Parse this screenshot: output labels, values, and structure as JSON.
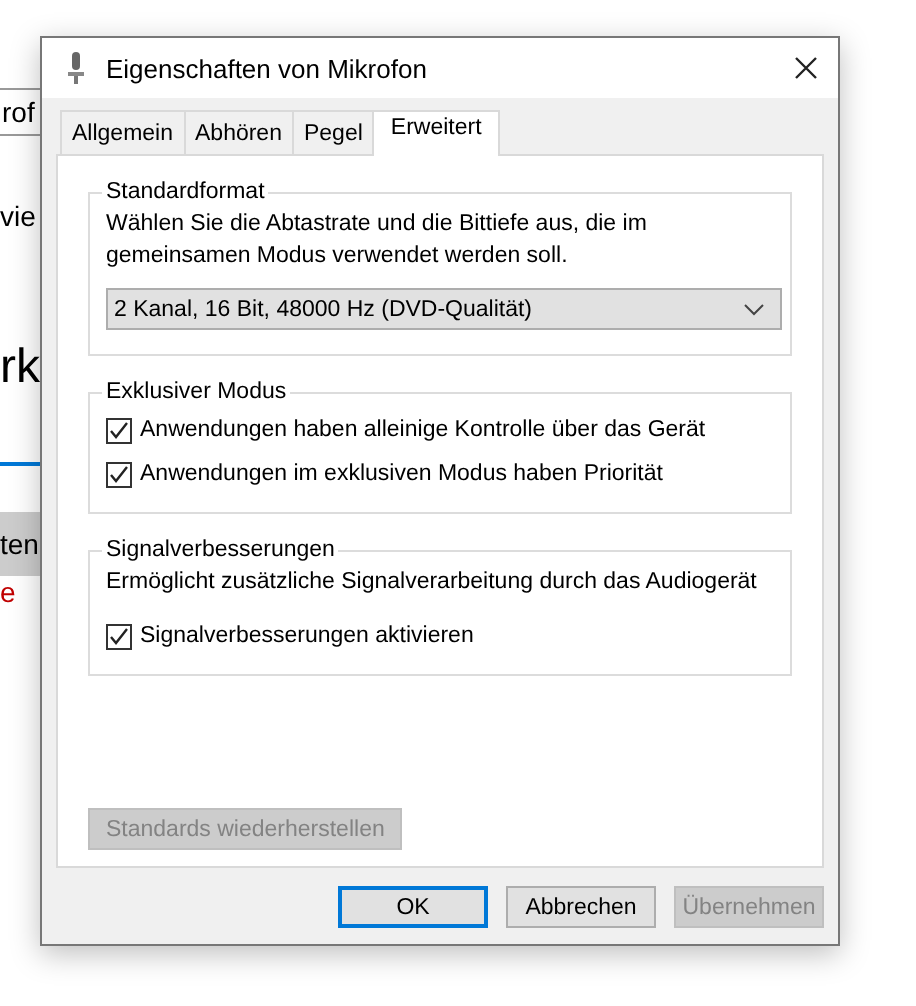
{
  "background_window": {
    "fragments": [
      {
        "kind": "field",
        "text": "rof"
      },
      {
        "kind": "text",
        "text": "vie"
      },
      {
        "kind": "heading",
        "text": "rk"
      },
      {
        "kind": "button",
        "text": "ten"
      },
      {
        "kind": "error",
        "text": "e"
      }
    ]
  },
  "dialog": {
    "title": "Eigenschaften von Mikrofon",
    "tabs": [
      {
        "label": "Allgemein",
        "selected": false
      },
      {
        "label": "Abhören",
        "selected": false
      },
      {
        "label": "Pegel",
        "selected": false
      },
      {
        "label": "Erweitert",
        "selected": true
      }
    ],
    "groups": [
      {
        "title": "Standardformat",
        "description": "Wählen Sie die Abtastrate und die Bittiefe aus, die im gemeinsamen Modus verwendet werden soll.",
        "select": {
          "value": "2 Kanal, 16 Bit, 48000 Hz (DVD-Qualität)"
        }
      },
      {
        "title": "Exklusiver Modus",
        "checkboxes": [
          {
            "label": "Anwendungen haben alleinige Kontrolle über das Gerät",
            "checked": true
          },
          {
            "label": "Anwendungen im exklusiven Modus haben Priorität",
            "checked": true
          }
        ]
      },
      {
        "title": "Signalverbesserungen",
        "description": "Ermöglicht zusätzliche Signalverarbeitung durch das Audiogerät",
        "checkboxes": [
          {
            "label": "Signalverbesserungen aktivieren",
            "checked": true
          }
        ]
      }
    ],
    "restore_button": {
      "label": "Standards wiederherstellen",
      "disabled": true
    },
    "buttons": [
      {
        "label": "OK",
        "default": true,
        "disabled": false
      },
      {
        "label": "Abbrechen",
        "default": false,
        "disabled": false
      },
      {
        "label": "Übernehmen",
        "default": false,
        "disabled": true
      }
    ]
  }
}
